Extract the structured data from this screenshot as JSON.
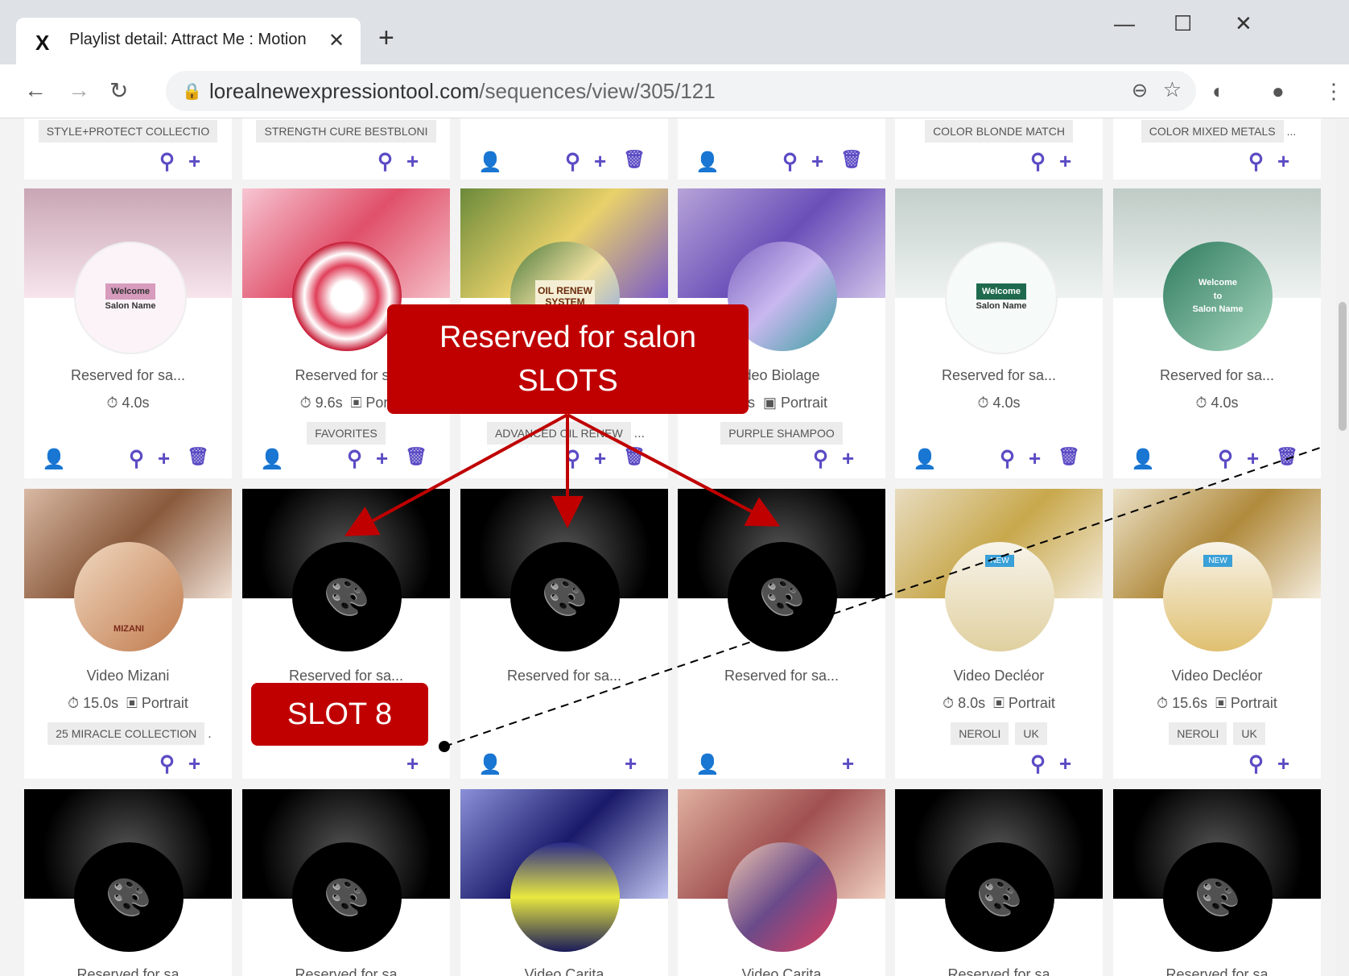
{
  "browser": {
    "tab_title": "Playlist detail: Attract Me : Motion",
    "tab_close": "✕",
    "new_tab": "+",
    "url_host": "lorealnewexpressiontool.com",
    "url_path": "/sequences/view/305/121",
    "win_minimize": "—",
    "win_maximize": "☐",
    "win_close": "✕"
  },
  "row0": {
    "tags": [
      "STYLE+PROTECT COLLECTIO",
      "STRENGTH CURE BESTBLONI",
      "",
      "",
      "COLOR BLONDE MATCH",
      "COLOR MIXED METALS"
    ],
    "more": "..."
  },
  "row1": [
    {
      "title": "Reserved for sa...",
      "duration": "4.0s",
      "format": "",
      "tag1": "",
      "tag2": ""
    },
    {
      "title": "Reserved for sa",
      "duration": "9.6s",
      "format": "Port",
      "tag1": "FAVORITES",
      "tag2": ""
    },
    {
      "title": "",
      "duration": "",
      "format": "",
      "tag1": "ADVANCED OIL RENEW",
      "tag2": "..."
    },
    {
      "title": "deo Biolage",
      "duration": ".0s",
      "format": "Portrait",
      "tag1": "PURPLE SHAMPOO",
      "tag2": ""
    },
    {
      "title": "Reserved for sa...",
      "duration": "4.0s",
      "format": "",
      "tag1": "",
      "tag2": ""
    },
    {
      "title": "Reserved for sa...",
      "duration": "4.0s",
      "format": "",
      "tag1": "",
      "tag2": ""
    }
  ],
  "row2": [
    {
      "title": "Video Mizani",
      "duration": "15.0s",
      "format": "Portrait",
      "tag1": "25 MIRACLE COLLECTION",
      "tag2": "."
    },
    {
      "title": "Reserved for sa...",
      "duration": "",
      "format": "",
      "tag1": "",
      "tag2": ""
    },
    {
      "title": "Reserved for sa...",
      "duration": "",
      "format": "",
      "tag1": "",
      "tag2": ""
    },
    {
      "title": "Reserved for sa...",
      "duration": "",
      "format": "",
      "tag1": "",
      "tag2": ""
    },
    {
      "title": "Video Decléor",
      "duration": "8.0s",
      "format": "Portrait",
      "tag1": "NEROLI",
      "tag2": "UK"
    },
    {
      "title": "Video Decléor",
      "duration": "15.6s",
      "format": "Portrait",
      "tag1": "NEROLI",
      "tag2": "UK"
    }
  ],
  "row3": [
    {
      "title": "Reserved for sa"
    },
    {
      "title": "Reserved for sa"
    },
    {
      "title": "Video Carita"
    },
    {
      "title": "Video Carita"
    },
    {
      "title": "Reserved for sa"
    },
    {
      "title": "Reserved for sa"
    }
  ],
  "thumb_text": {
    "welcome": "Welcome",
    "to": "to",
    "salon_name": "Salon Name",
    "oil_renew": "OIL RENEW SYSTEM",
    "mizani": "MIZANI",
    "new": "NEW"
  },
  "annotations": {
    "reserved_callout": "Reserved for salon SLOTS",
    "slot8_callout": "SLOT 8"
  },
  "icons": {
    "search": "⚲",
    "add": "+",
    "trash": "🗑",
    "user": "👤",
    "timer": "⏱",
    "portrait": "▣",
    "palette": "🎨"
  },
  "colors": {
    "accent": "#5b4cc4",
    "callout": "#c00000",
    "user_active": "#2e8b57"
  }
}
